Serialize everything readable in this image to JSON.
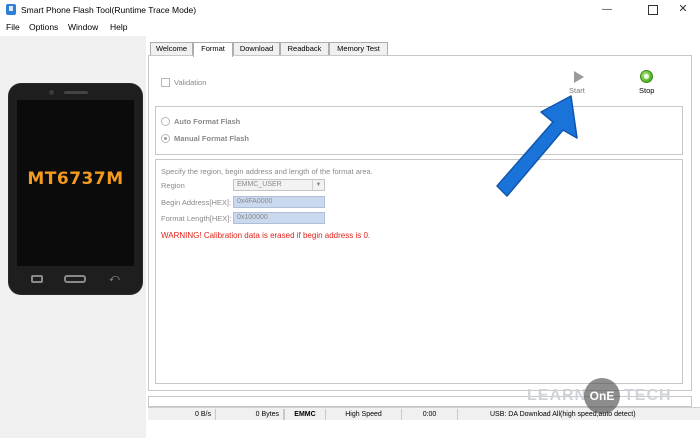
{
  "window": {
    "title": "Smart Phone Flash Tool(Runtime Trace Mode)",
    "min_glyph": "—",
    "close_glyph": "✕"
  },
  "menu": {
    "items": [
      "File",
      "Options",
      "Window",
      "Help"
    ]
  },
  "device": {
    "chip": "MT6737M"
  },
  "tabs": [
    "Welcome",
    "Format",
    "Download",
    "Readback",
    "Memory Test"
  ],
  "active_tab": "Format",
  "format": {
    "validation_label": "Validation",
    "start_label": "Start",
    "stop_label": "Stop",
    "auto_format_label": "Auto Format Flash",
    "manual_format_label": "Manual Format Flash",
    "description": "Specify the region, begin address and length of the format area.",
    "region_label": "Region",
    "region_value": "EMMC_USER",
    "begin_label": "Begin Address[HEX]:",
    "begin_value": "0x4FA0000",
    "length_label": "Format Length[HEX]:",
    "length_value": "0x100000",
    "warning": "WARNING! Calibration data is erased if begin address is 0."
  },
  "status": {
    "speed": "0 B/s",
    "bytes": "0 Bytes",
    "storage": "EMMC",
    "mode": "High Speed",
    "time": "0:00",
    "connection": "USB: DA Download All(high speed,auto detect)"
  },
  "watermark": {
    "left": "LEARN",
    "circle": "OnE",
    "right": "TECH"
  },
  "colors": {
    "accent_arrow": "#1a73d9",
    "warning": "#e2231a",
    "chip": "#f39a1f",
    "stop_green": "#4cb21f"
  }
}
